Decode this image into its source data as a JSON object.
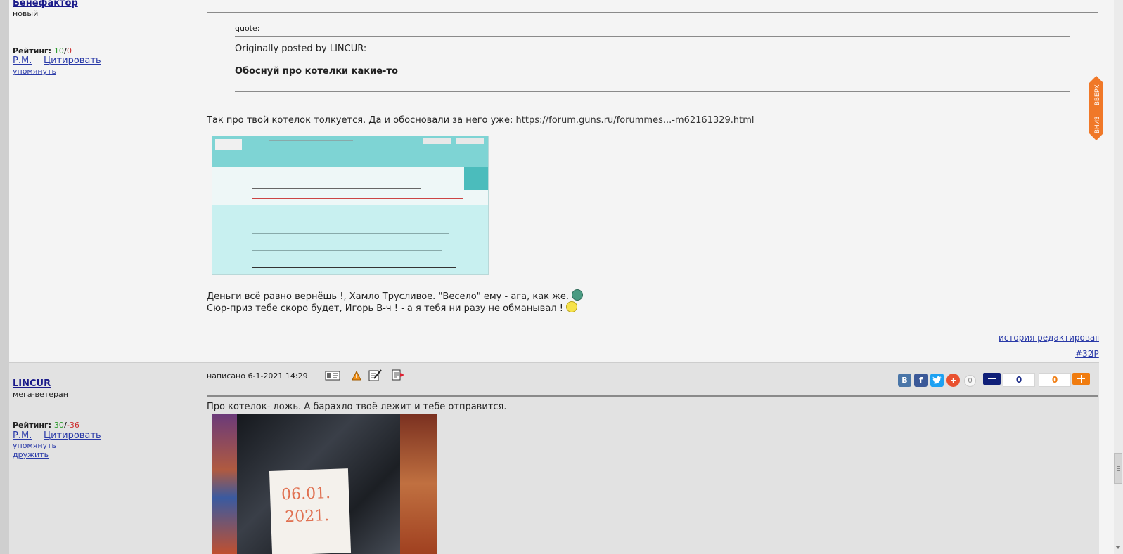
{
  "post1": {
    "username": "Бенефактор",
    "status": "новый",
    "rating_label": "Рейтинг:",
    "rating_pos": "10",
    "rating_sep": "/",
    "rating_neg": "0",
    "pm_label": "Р.М.",
    "quote_label": "Цитировать",
    "mention_label": "упомянуть",
    "quote_header": "quote:",
    "quote_origin": "Originally posted by LINCUR:",
    "quote_text": "Обоснуй про котелки какие-то",
    "body_text_1": "Так про твой котелок толкуется. Да и обосновали за него уже:",
    "body_link": "https://forum.guns.ru/forummes...-m62161329.html",
    "body_text_2": "Деньги всё равно вернёшь !, Хамло Трусливое. \"Весело\" ему - ага, как же.",
    "body_text_3": "Сюр-приз тебе скоро будет, Игорь В-ч ! - а я тебя ни разу не обманывал !",
    "edit_history": "история редактирования",
    "post_number": "#32",
    "ip_label": "IP"
  },
  "post2": {
    "username": "LINCUR",
    "status": "мега-ветеран",
    "rating_label": "Рейтинг:",
    "rating_pos": "30",
    "rating_sep": "/",
    "rating_neg": "-36",
    "pm_label": "Р.М.",
    "quote_label": "Цитировать",
    "mention_label": "упомянуть",
    "friend_label": "дружить",
    "posted_at": "написано 6-1-2021 14:29",
    "body_text": "Про котелок- ложь. А барахло твоё лежит и тебе отправится.",
    "photo_note_1": "06.01.",
    "photo_note_2": "2021.",
    "share_count": "0",
    "vote_minus": "0",
    "vote_plus": "0"
  },
  "nav": {
    "up_label": "ВВЕРХ",
    "down_label": "ВНИЗ"
  },
  "colors": {
    "accent_orange": "#f07828",
    "link_blue": "#2a3aa8",
    "vk": "#4a76a8",
    "facebook": "#3b5998",
    "twitter": "#1da1f2",
    "plus": "#e9512f",
    "minus_btn": "#0f1f78",
    "plus_btn": "#f07c10"
  }
}
